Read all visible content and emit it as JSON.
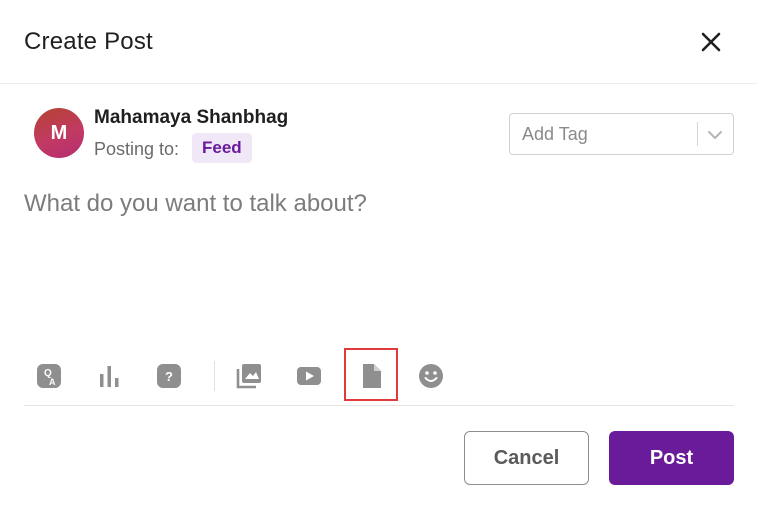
{
  "dialog": {
    "title": "Create Post"
  },
  "user": {
    "initial": "M",
    "name": "Mahamaya Shanbhag",
    "posting_label": "Posting to:",
    "destination": "Feed"
  },
  "tag_select": {
    "placeholder": "Add Tag"
  },
  "composer": {
    "placeholder": "What do you want to talk about?"
  },
  "toolbar": {
    "icons": [
      "qa-icon",
      "poll-icon",
      "question-icon",
      "image-icon",
      "video-icon",
      "document-icon",
      "emoji-icon"
    ],
    "highlighted": "document-icon"
  },
  "actions": {
    "cancel_label": "Cancel",
    "post_label": "Post"
  },
  "colors": {
    "accent": "#6a1b9a",
    "chip_bg": "#f1e8f7",
    "highlight": "#e03a3a",
    "icon": "#8f8f8f"
  }
}
